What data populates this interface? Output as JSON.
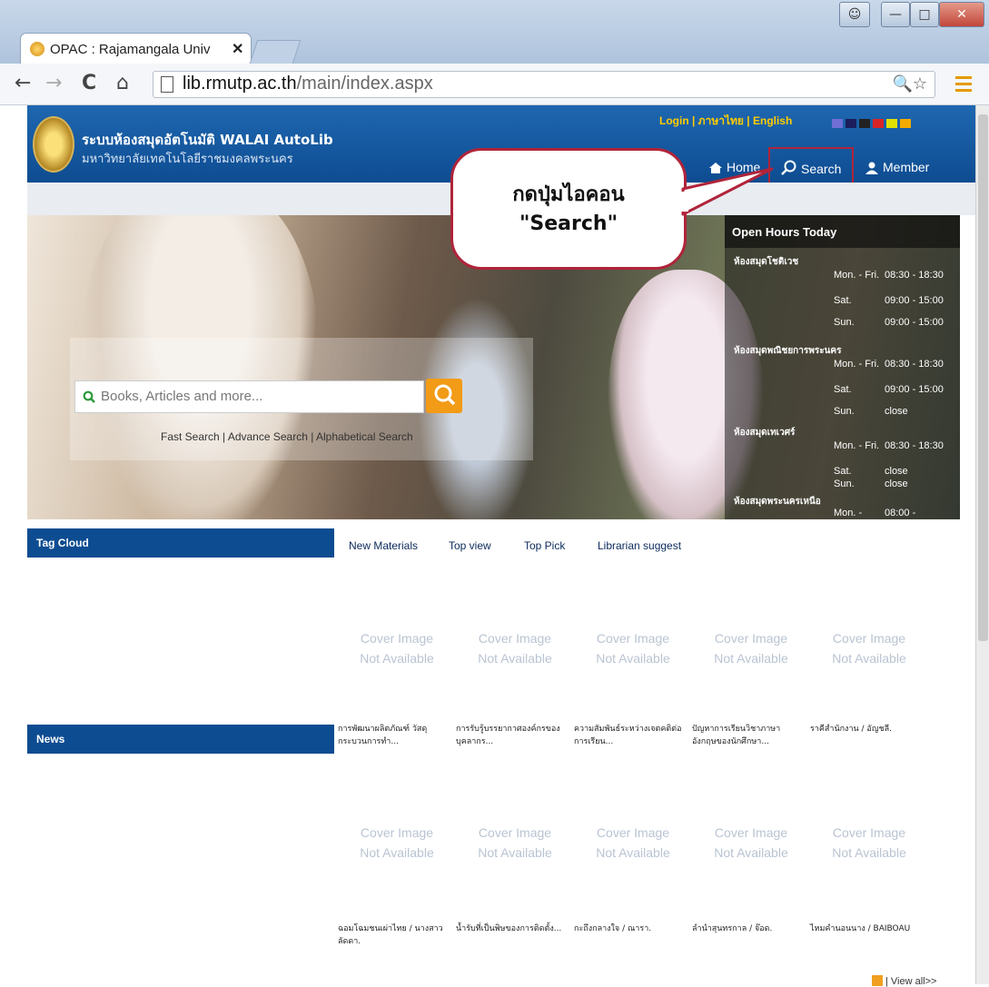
{
  "browser": {
    "tab_title": "OPAC : Rajamangala Univ",
    "tab_close": "✕",
    "url_host": "lib.rmutp.ac.th",
    "url_path": "/main/index.aspx"
  },
  "site": {
    "title_line1": "ระบบห้องสมุดอัตโนมัติ WALAI AutoLib",
    "title_line2": "มหาวิทยาลัยเทคโนโลยีราชมงคลพระนคร",
    "top_links": "Login | ภาษาไทย | English",
    "theme_colors": [
      "#6f6fd6",
      "#1c1c5c",
      "#222222",
      "#d92525",
      "#e0e000",
      "#f2a900"
    ]
  },
  "nav": {
    "home": "Home",
    "search": "Search",
    "member": "Member"
  },
  "callout": {
    "line1": "กดปุ่มไอคอน",
    "line2": "\"Search\""
  },
  "search": {
    "placeholder": "Books, Articles and more...",
    "links": "Fast Search | Advance Search | Alphabetical Search"
  },
  "hours": {
    "title": "Open Hours Today",
    "locations": [
      {
        "name": "ห้องสมุดโชติเวช",
        "rows": [
          [
            "Mon. - Fri.",
            "08:30 - 18:30"
          ],
          [
            "Sat.",
            "09:00 - 15:00"
          ],
          [
            "Sun.",
            "09:00 - 15:00"
          ]
        ]
      },
      {
        "name": "ห้องสมุดพณิชยการพระนคร",
        "rows": [
          [
            "Mon. - Fri.",
            "08:30 - 18:30"
          ],
          [
            "Sat.",
            "09:00 - 15:00"
          ],
          [
            "Sun.",
            "close"
          ]
        ]
      },
      {
        "name": "ห้องสมุดเทเวศร์",
        "rows": [
          [
            "Mon. - Fri.",
            "08:30 - 18:30"
          ],
          [
            "Sat.",
            "close"
          ],
          [
            "Sun.",
            "close"
          ]
        ]
      },
      {
        "name": "ห้องสมุดพระนครเหนือ",
        "rows": [
          [
            "Mon. -",
            "08:00 -"
          ]
        ]
      }
    ]
  },
  "sidebar": {
    "tag_cloud": "Tag Cloud",
    "news": "News"
  },
  "tabs": [
    "New Materials",
    "Top view",
    "Top Pick",
    "Librarian suggest"
  ],
  "cover_text": [
    "Cover Image",
    "Not Available"
  ],
  "row1_items": [
    "การพัฒนาผลิตภัณฑ์ วัสดุกระบวนการทำ...",
    "การรับรู้บรรยากาศองค์กรของบุคลากร...",
    "ความสัมพันธ์ระหว่างเจตคติต่อการเรียน...",
    "ปัญหาการเรียนวิชาภาษาอังกฤษของนักศึกษา...",
    "ราคีสำนักงาน / อัญชลี."
  ],
  "row2_items": [
    "ฉอมโฉมชนเผ่าไทย / นางสาวลัดดา.",
    "น้ำรับที่เป็นพิษของการติดตั้ง...",
    "กะถึงกลางใจ / ณารา.",
    "ลำนำสุนทรกาล / จ๊อด.",
    "ไหมคำนอนนาง / BAIBOAU"
  ],
  "view_all": "| View all>>"
}
